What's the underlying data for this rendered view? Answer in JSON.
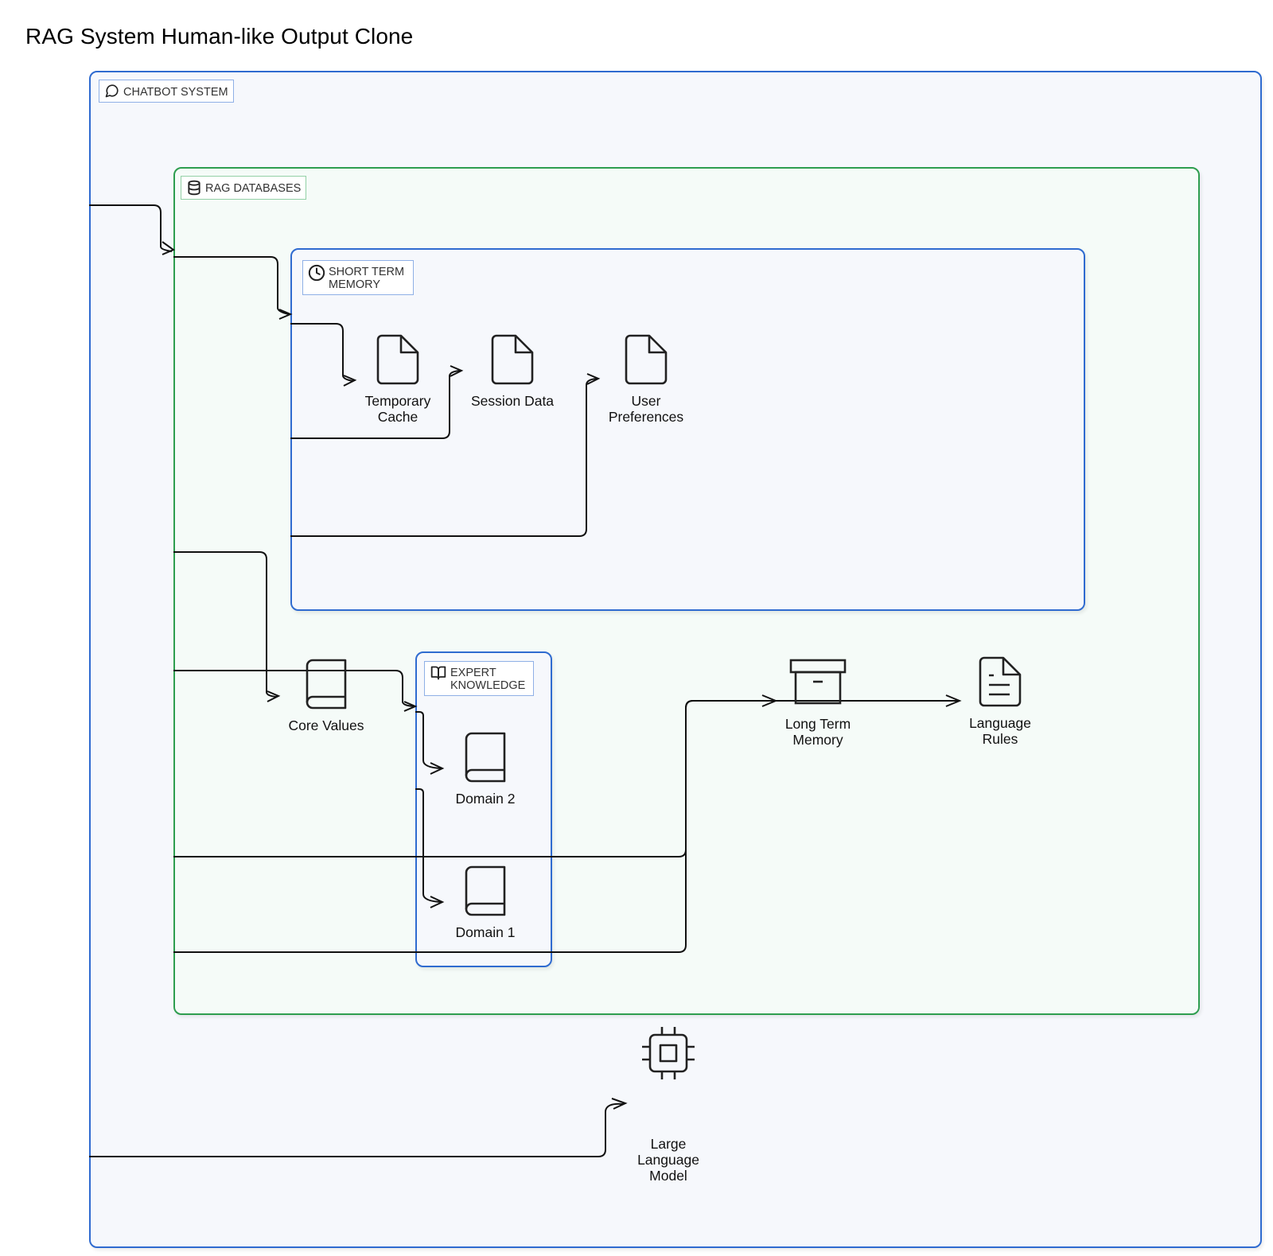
{
  "title": "RAG System Human-like Output Clone",
  "groups": {
    "chatbot_system": {
      "label": "Chatbot System",
      "icon": "message-circle-icon",
      "color": "#2f6bd0"
    },
    "rag_databases": {
      "label": "RAG Databases",
      "icon": "database-icon",
      "color": "#2e9e4f"
    },
    "short_term_memory": {
      "label": "Short Term Memory",
      "icon": "clock-icon",
      "color": "#2f6bd0"
    },
    "expert_knowledge": {
      "label": "Expert Knowledge",
      "icon": "book-open-icon",
      "color": "#2f6bd0"
    }
  },
  "nodes": {
    "temporary_cache": {
      "label": "Temporary\nCache",
      "icon": "file-icon"
    },
    "session_data": {
      "label": "Session Data",
      "icon": "file-icon"
    },
    "user_preferences": {
      "label": "User\nPreferences",
      "icon": "file-icon"
    },
    "core_values": {
      "label": "Core Values",
      "icon": "book-icon"
    },
    "domain_2": {
      "label": "Domain 2",
      "icon": "book-icon"
    },
    "domain_1": {
      "label": "Domain 1",
      "icon": "book-icon"
    },
    "long_term_memory": {
      "label": "Long Term\nMemory",
      "icon": "archive-icon"
    },
    "language_rules": {
      "label": "Language\nRules",
      "icon": "file-text-icon"
    },
    "large_language_model": {
      "label": "Large\nLanguage\nModel",
      "icon": "cpu-icon"
    }
  },
  "edges": [
    {
      "from": "chatbot_system",
      "to": "rag_databases"
    },
    {
      "from": "rag_databases",
      "to": "short_term_memory"
    },
    {
      "from": "short_term_memory",
      "to": "temporary_cache"
    },
    {
      "from": "short_term_memory",
      "to": "session_data"
    },
    {
      "from": "short_term_memory",
      "to": "user_preferences"
    },
    {
      "from": "rag_databases",
      "to": "core_values"
    },
    {
      "from": "rag_databases",
      "to": "expert_knowledge"
    },
    {
      "from": "expert_knowledge",
      "to": "domain_2"
    },
    {
      "from": "expert_knowledge",
      "to": "domain_1"
    },
    {
      "from": "rag_databases",
      "to": "long_term_memory"
    },
    {
      "from": "rag_databases",
      "to": "language_rules"
    },
    {
      "from": "chatbot_system",
      "to": "large_language_model"
    }
  ]
}
